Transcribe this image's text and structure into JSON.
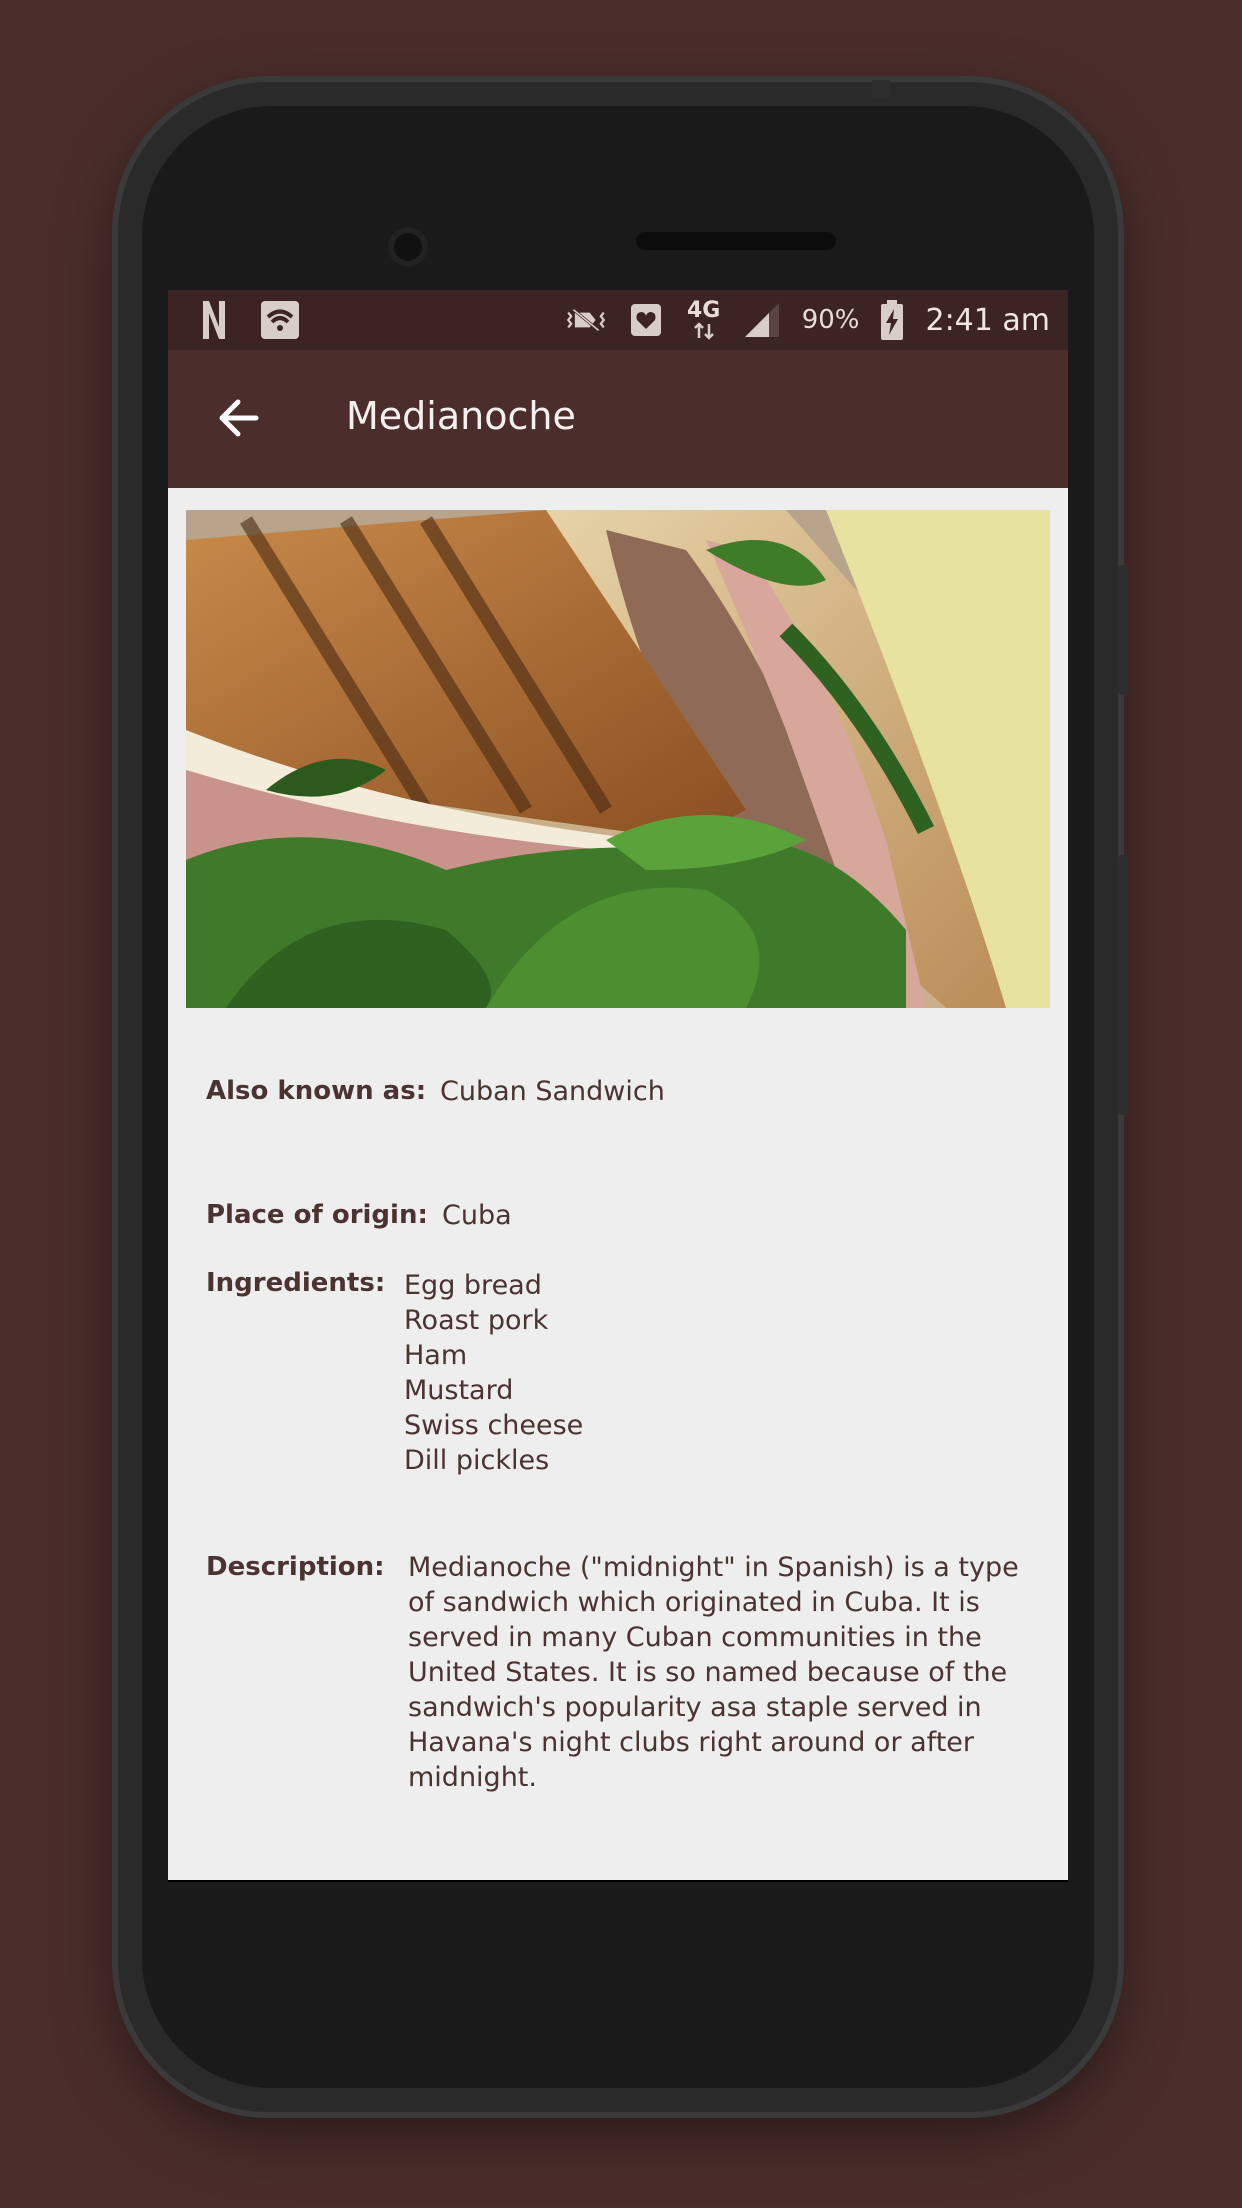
{
  "status_bar": {
    "left_icons": [
      "netflix-icon",
      "wifi-icon"
    ],
    "right_icons": [
      "vibrate-icon",
      "heart-icon",
      "network-4g-icon",
      "signal-icon",
      "battery-icon"
    ],
    "network": "4G",
    "battery": "90%",
    "time": "2:41 am"
  },
  "app_bar": {
    "title": "Medianoche",
    "back_icon": "arrow-back-icon"
  },
  "hero": {
    "image": "medianoche-sandwich-photo"
  },
  "details": {
    "also_known_as": {
      "label": "Also known as:",
      "value": "Cuban Sandwich"
    },
    "place_of_origin": {
      "label": "Place of origin:",
      "value": "Cuba"
    },
    "ingredients": {
      "label": "Ingredients:",
      "items": [
        "Egg bread",
        "Roast pork",
        "Ham",
        "Mustard",
        "Swiss cheese",
        "Dill pickles"
      ]
    },
    "description": {
      "label": "Description:",
      "value": "Medianoche (\"midnight\" in Spanish) is a type of sandwich which originated in Cuba. It is served in many Cuban communities in the United States. It is so named because of the sandwich's popularity asa staple served in Havana's night clubs right around or after midnight."
    }
  },
  "colors": {
    "background": "#4b2e2b",
    "app_bar": "#4b2e2b",
    "status_bar": "#3b2421",
    "content_bg": "#eeeeee",
    "text": "#4a3330"
  }
}
